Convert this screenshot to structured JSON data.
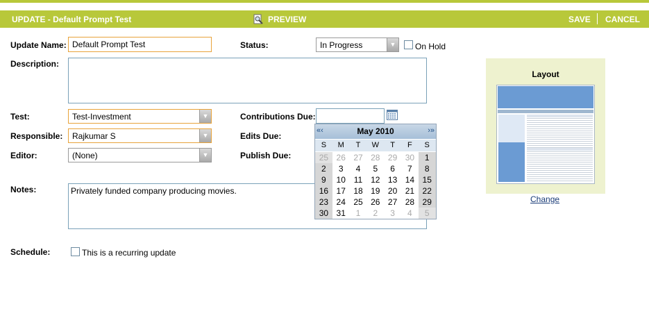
{
  "header": {
    "title": "UPDATE - Default Prompt Test",
    "preview_label": "PREVIEW",
    "save_label": "SAVE",
    "cancel_label": "CANCEL"
  },
  "form": {
    "update_name": {
      "label": "Update Name:",
      "value": "Default Prompt Test"
    },
    "status": {
      "label": "Status:",
      "value": "In Progress"
    },
    "on_hold": {
      "label": "On Hold",
      "checked": false
    },
    "description": {
      "label": "Description:",
      "value": ""
    },
    "test": {
      "label": "Test:",
      "value": "Test-Investment"
    },
    "responsible": {
      "label": "Responsible:",
      "value": "Rajkumar S"
    },
    "editor": {
      "label": "Editor:",
      "value": "(None)"
    },
    "contributions_due": {
      "label": "Contributions Due:",
      "value": ""
    },
    "edits_due": {
      "label": "Edits Due:"
    },
    "publish_due": {
      "label": "Publish Due:"
    },
    "notes": {
      "label": "Notes:",
      "value": "Privately funded company producing movies."
    },
    "schedule": {
      "label": "Schedule:",
      "recurring_label": "This is a recurring update",
      "checked": false
    }
  },
  "layout_panel": {
    "title": "Layout",
    "change_label": "Change"
  },
  "calendar": {
    "month_label": "May 2010",
    "prev_symbol": "«‹",
    "next_symbol": "›»",
    "day_headers": [
      "S",
      "M",
      "T",
      "W",
      "T",
      "F",
      "S"
    ],
    "weeks": [
      [
        {
          "d": "25",
          "o": true
        },
        {
          "d": "26",
          "o": true
        },
        {
          "d": "27",
          "o": true
        },
        {
          "d": "28",
          "o": true
        },
        {
          "d": "29",
          "o": true
        },
        {
          "d": "30",
          "o": true
        },
        {
          "d": "1",
          "o": false
        }
      ],
      [
        {
          "d": "2",
          "o": false
        },
        {
          "d": "3",
          "o": false
        },
        {
          "d": "4",
          "o": false
        },
        {
          "d": "5",
          "o": false
        },
        {
          "d": "6",
          "o": false
        },
        {
          "d": "7",
          "o": false
        },
        {
          "d": "8",
          "o": false
        }
      ],
      [
        {
          "d": "9",
          "o": false
        },
        {
          "d": "10",
          "o": false
        },
        {
          "d": "11",
          "o": false
        },
        {
          "d": "12",
          "o": false
        },
        {
          "d": "13",
          "o": false
        },
        {
          "d": "14",
          "o": false
        },
        {
          "d": "15",
          "o": false
        }
      ],
      [
        {
          "d": "16",
          "o": false
        },
        {
          "d": "17",
          "o": false
        },
        {
          "d": "18",
          "o": false
        },
        {
          "d": "19",
          "o": false
        },
        {
          "d": "20",
          "o": false
        },
        {
          "d": "21",
          "o": false
        },
        {
          "d": "22",
          "o": false
        }
      ],
      [
        {
          "d": "23",
          "o": false
        },
        {
          "d": "24",
          "o": false
        },
        {
          "d": "25",
          "o": false
        },
        {
          "d": "26",
          "o": false
        },
        {
          "d": "27",
          "o": false
        },
        {
          "d": "28",
          "o": false
        },
        {
          "d": "29",
          "o": false
        }
      ],
      [
        {
          "d": "30",
          "o": false
        },
        {
          "d": "31",
          "o": false
        },
        {
          "d": "1",
          "o": true
        },
        {
          "d": "2",
          "o": true
        },
        {
          "d": "3",
          "o": true
        },
        {
          "d": "4",
          "o": true
        },
        {
          "d": "5",
          "o": true
        }
      ]
    ]
  },
  "colors": {
    "accent": "#b8c83a",
    "input_border": "#e8a33a",
    "layout_bg": "#eef2cf",
    "link": "#1a3c78"
  },
  "icons": {
    "preview": "magnifier-page-icon",
    "calendar": "calendar-icon",
    "dropdown": "chevron-down-icon"
  }
}
